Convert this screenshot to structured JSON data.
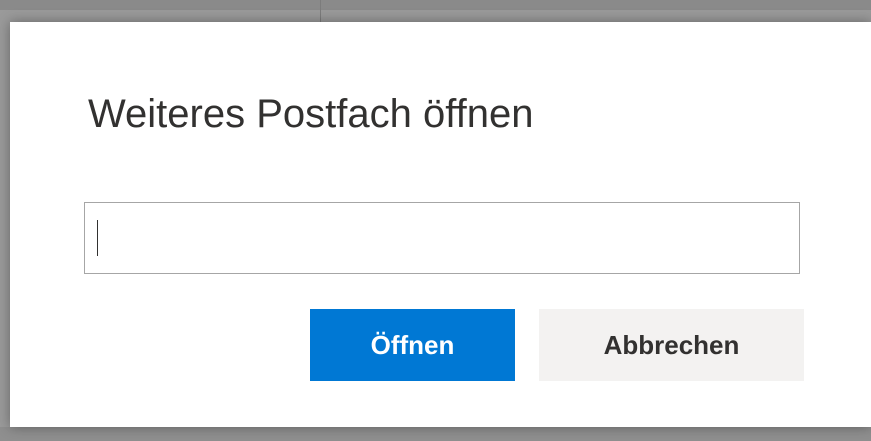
{
  "dialog": {
    "title": "Weiteres Postfach öffnen",
    "mailbox_input": {
      "value": "",
      "placeholder": ""
    },
    "open_button_label": "Öffnen",
    "cancel_button_label": "Abbrechen"
  },
  "colors": {
    "primary": "#0078d4",
    "secondary_bg": "#f3f2f1",
    "text": "#323130",
    "overlay": "#9a9a9a"
  }
}
